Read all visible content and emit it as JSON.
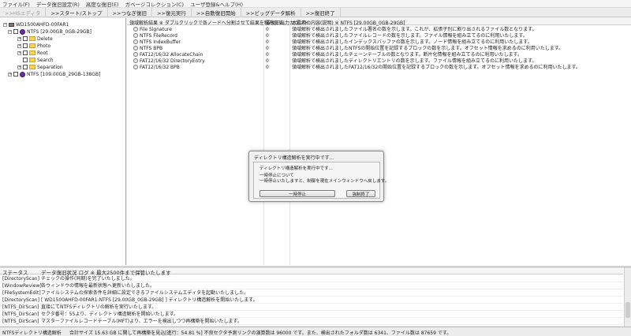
{
  "menu": [
    "ファイル(F)",
    "データ復旧設定(R)",
    "高度な復旧(E)",
    "ガベージコレクション(C)",
    "ユーザ登録&ヘルプ(H)"
  ],
  "toolbar": [
    {
      "label": ">>HSエディタ",
      "enabled": false
    },
    {
      "label": ">>スタート/ストップ",
      "enabled": true
    },
    {
      "label": ">>つなぎ復旧",
      "enabled": true
    },
    {
      "label": ">>復元実行",
      "enabled": true
    },
    {
      "label": ">>自動復旧開始",
      "enabled": true
    },
    {
      "label": ">>ビッグデータ解析",
      "enabled": true
    },
    {
      "label": ">>復旧終了",
      "enabled": true
    }
  ],
  "tree": {
    "disk": "WD1500AHFD-00FAR1",
    "volume1": "NTFS [29.00GB_0GB-29GB]",
    "folders": [
      "Delete",
      "Photo",
      "Root",
      "Search",
      "Separation"
    ],
    "volume2": "NTFS [109.00GB_29GB-138GB]"
  },
  "list": {
    "headers": [
      "領域解析結果 ※ ダブルクリックで各ノードへ分割させて結果を積みます。",
      "要復旧出力カウント",
      "本要素の内容(説明) ※ NTFS [29.00GB_0GB-29GB]"
    ],
    "rows": [
      {
        "name": "File Signature",
        "count": "0",
        "desc": "領域解析で検出されましたファイル署名の数を示します。これが、拡張子別に割り出されるファイル数となります。"
      },
      {
        "name": "NTFS FileRecord",
        "count": "0",
        "desc": "領域解析で検出されましたファイルレコードの数を示します。ファイル情報を組み立てるのに利用いたします。"
      },
      {
        "name": "NTFS IndexBuffer",
        "count": "0",
        "desc": "領域解析で検出されましたインデックスバッファの数を示します。ノード情報を組み立てるのに利用いたします。"
      },
      {
        "name": "NTFS BPB",
        "count": "0",
        "desc": "領域解析で検出されましたNTFSの開始位置を記録するブロックの数を示します。オフセット情報を求めるのに利用いたします。"
      },
      {
        "name": "FAT12/16/32 AllocateChain",
        "count": "0",
        "desc": "領域解析で検出されましたチェーンテーブルの数となります。断片化情報を組み立てるのに利用いたします。"
      },
      {
        "name": "FAT12/16/32 DirectoryEntry",
        "count": "0",
        "desc": "領域解析で検出されましたディレクトリエントリの数を示します。ファイル情報を組み立てるのに利用いたします。"
      },
      {
        "name": "FAT12/16/32 BPB",
        "count": "0",
        "desc": "領域解析で検出されましたFAT12/16/32の開始位置を記録するブロックの数を示します。オフセット情報を求めるのに利用いたします。"
      }
    ]
  },
  "dialog": {
    "title": "ディレクトリ構造解析を実行中です...",
    "line1": "ディレクトリ構造解析を実行中です...",
    "line2": "一時停止について",
    "line3": "一時停止いたしますと、制御を現在メインウィンドウへ戻します。",
    "pause_button": "一時停止",
    "force_button": "強制終了"
  },
  "log": {
    "header_status": "ステータス",
    "header_text": "データ復旧状況 ログ ※ 最大2500件まで保管いたします",
    "rows": [
      {
        "tag": "[DirectoryScan]",
        "msg": "チェックの操作(同期)を完了いたしました。"
      },
      {
        "tag": "[WindowReview]",
        "msg": "各ウィンドウの情報を最新状態へ更新いたしました。"
      },
      {
        "tag": "[FileSystemEdit]",
        "msg": "ファイルシステムの探索条件を詳細に設定できるファイルシステムエディタを起動いたしました。"
      },
      {
        "tag": "[DirectoryScan]",
        "msg": "[ WD1500AHFD-00FAR1:NTFS [29.00GB_0GB-29GB] ] ディレクトリ構造解析を開始いたします。"
      },
      {
        "tag": "[NTFS_DirScan]",
        "msg": "直接にてNTFSディレクトリの解析を実行いたします。"
      },
      {
        "tag": "[NTFS_DirScan]",
        "msg": "セクタ番号：55より、ディレクトリ構造解析を開始いたします。"
      },
      {
        "tag": "[NTFS_DirScan]",
        "msg": "マスターファイルレコードテーブル(MFT)より、エラーを検出しつつ再構築を開始いたします。"
      }
    ]
  },
  "status": {
    "left": "NTFSディレクトリ構造解析",
    "right": "合計サイズ 15.63 GB に関して再構築を見込[進行：54.81 %] 不良セクタ予測リンクの演算数は 96000 です。また、検出されたフォルダ数は 6341、ファイル数は 87659 です。"
  }
}
